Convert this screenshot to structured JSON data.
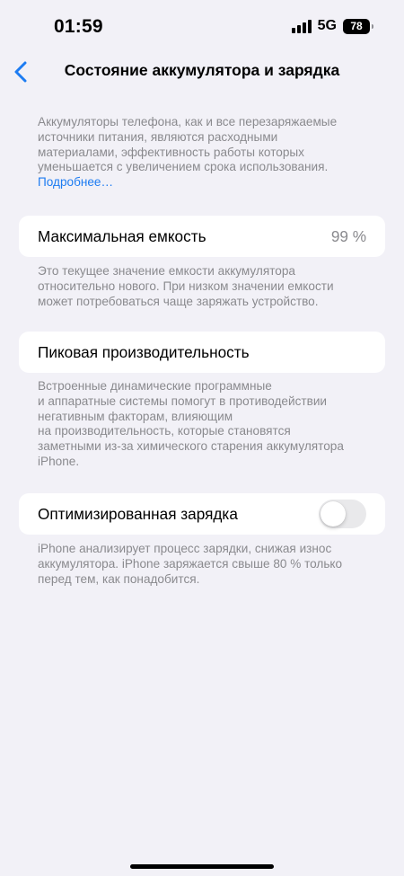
{
  "status_bar": {
    "time": "01:59",
    "network": "5G",
    "battery_level": "78"
  },
  "nav": {
    "title": "Состояние аккумулятора и зарядка"
  },
  "intro": {
    "lines": [
      "Аккумуляторы телефона, как и все перезаряжаемые",
      "источники питания, являются расходными",
      "материалами, эффективность работы которых",
      "уменьшается с увеличением срока использования."
    ],
    "link": "Подробнее…"
  },
  "max_capacity": {
    "label": "Максимальная емкость",
    "value": "99 %",
    "footer_lines": [
      "Это текущее значение емкости аккумулятора",
      "относительно нового. При низком значении емкости",
      "может потребоваться чаще заряжать устройство."
    ]
  },
  "peak_performance": {
    "label": "Пиковая производительность",
    "footer_lines": [
      "Встроенные динамические программные",
      "и аппаратные системы помогут в противодействии",
      "негативным факторам, влияющим",
      "на производительность, которые становятся",
      "заметными из-за химического старения аккумулятора",
      "iPhone."
    ]
  },
  "optimized_charging": {
    "label": "Оптимизированная зарядка",
    "enabled": false,
    "footer_lines": [
      "iPhone анализирует процесс зарядки, снижая износ",
      "аккумулятора. iPhone заряжается свыше 80 % только",
      "перед тем, как понадобится."
    ]
  },
  "colors": {
    "background": "#f2f1f7",
    "accent": "#1d7cf2",
    "secondary_text": "#8a8a8e",
    "toggle_off": "#e9e9eb"
  }
}
